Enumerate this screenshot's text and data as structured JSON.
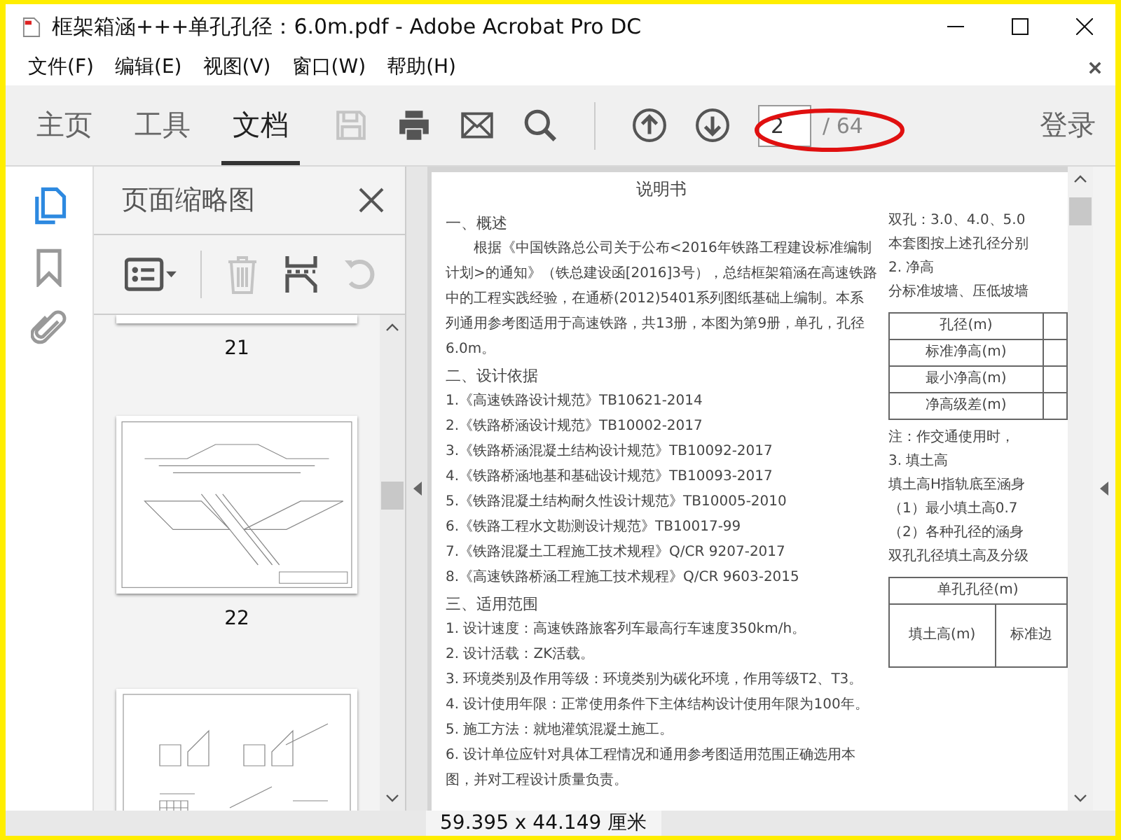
{
  "window": {
    "title": "框架箱涵+++单孔孔径：6.0m.pdf - Adobe Acrobat Pro DC"
  },
  "menu": [
    "文件(F)",
    "编辑(E)",
    "视图(V)",
    "窗口(W)",
    "帮助(H)"
  ],
  "tabs": [
    {
      "label": "主页",
      "selected": false
    },
    {
      "label": "工具",
      "selected": false
    },
    {
      "label": "文档",
      "selected": true
    }
  ],
  "tools": [
    {
      "kind": "save",
      "disabled": true
    },
    {
      "kind": "print",
      "disabled": false
    },
    {
      "kind": "mail",
      "disabled": false
    },
    {
      "kind": "search",
      "disabled": false
    }
  ],
  "nav": [
    {
      "kind": "up",
      "disabled": false
    },
    {
      "kind": "down",
      "disabled": false
    }
  ],
  "page_field": {
    "value": "2",
    "count": "/ 64"
  },
  "sign_in": "登录",
  "rail": [
    {
      "kind": "pages",
      "selected": true
    },
    {
      "kind": "bookmark",
      "selected": false
    },
    {
      "kind": "attachment",
      "selected": false
    }
  ],
  "thumbnail_panel": {
    "title": "页面缩略图",
    "tools": [
      {
        "kind": "options",
        "disabled": false
      },
      {
        "kind": "delete",
        "disabled": true
      },
      {
        "kind": "extract",
        "disabled": false
      },
      {
        "kind": "rotate",
        "disabled": true
      }
    ],
    "pages": [
      {
        "kind": "partial",
        "label": "21"
      },
      {
        "kind": "section-drawing",
        "label": "22"
      },
      {
        "kind": "grid-drawing"
      }
    ]
  },
  "document": {
    "title": "说明书",
    "left": [
      {
        "kind": "heading",
        "text": "一、概述"
      },
      {
        "kind": "paragraph",
        "text": "根据《中国铁路总公司关于公布<2016年铁路工程建设标准编制计划>的通知》（铁总建设函[2016]3号），总结框架箱涵在高速铁路中的工程实践经验，在通桥(2012)5401系列图纸基础上编制。本系列通用参考图适用于高速铁路，共13册，本图为第9册，单孔，孔径6.0m。"
      },
      {
        "kind": "heading",
        "text": "二、设计依据"
      },
      {
        "kind": "item",
        "text": "1.《高速铁路设计规范》TB10621-2014"
      },
      {
        "kind": "item",
        "text": "2.《铁路桥涵设计规范》TB10002-2017"
      },
      {
        "kind": "item",
        "text": "3.《铁路桥涵混凝土结构设计规范》TB10092-2017"
      },
      {
        "kind": "item",
        "text": "4.《铁路桥涵地基和基础设计规范》TB10093-2017"
      },
      {
        "kind": "item",
        "text": "5.《铁路混凝土结构耐久性设计规范》TB10005-2010"
      },
      {
        "kind": "item",
        "text": "6.《铁路工程水文勘测设计规范》TB10017-99"
      },
      {
        "kind": "item",
        "text": "7.《铁路混凝土工程施工技术规程》Q/CR 9207-2017"
      },
      {
        "kind": "item",
        "text": "8.《高速铁路桥涵工程施工技术规程》Q/CR 9603-2015"
      },
      {
        "kind": "heading",
        "text": "三、适用范围"
      },
      {
        "kind": "item",
        "text": "1. 设计速度：高速铁路旅客列车最高行车速度350km/h。"
      },
      {
        "kind": "item",
        "text": "2. 设计活载：ZK活载。"
      },
      {
        "kind": "item",
        "text": "3. 环境类别及作用等级：环境类别为碳化环境，作用等级T2、T3。"
      },
      {
        "kind": "item",
        "text": "4. 设计使用年限：正常使用条件下主体结构设计使用年限为100年。"
      },
      {
        "kind": "item",
        "text": "5. 施工方法：就地灌筑混凝土施工。"
      },
      {
        "kind": "item",
        "text": "6. 设计单位应针对具体工程情况和通用参考图适用范围正确选用本图，并对工程设计质量负责。"
      }
    ],
    "right": [
      {
        "kind": "text",
        "text": "双孔：3.0、4.0、5.0"
      },
      {
        "kind": "text",
        "text": "本套图按上述孔径分别"
      },
      {
        "kind": "text",
        "text": "2. 净高"
      },
      {
        "kind": "text",
        "text": "分标准坡墙、压低坡墙"
      },
      {
        "kind": "table",
        "rows": [
          "孔径(m)",
          "标准净高(m)",
          "最小净高(m)",
          "净高级差(m)"
        ]
      },
      {
        "kind": "text",
        "text": "注：作交通使用时，"
      },
      {
        "kind": "text",
        "text": "3. 填土高"
      },
      {
        "kind": "text",
        "text": "填土高H指轨底至涵身"
      },
      {
        "kind": "text",
        "text": "（1）最小填土高0.7"
      },
      {
        "kind": "text",
        "text": "（2）各种孔径的涵身"
      },
      {
        "kind": "text",
        "text": "双孔孔径填土高及分级"
      },
      {
        "kind": "grid",
        "header": "单孔孔径(m)",
        "row_label": "填土高(m)",
        "sub_label": "标准边"
      }
    ]
  },
  "status_bar": {
    "dimensions": "59.395 x 44.149 厘米"
  }
}
